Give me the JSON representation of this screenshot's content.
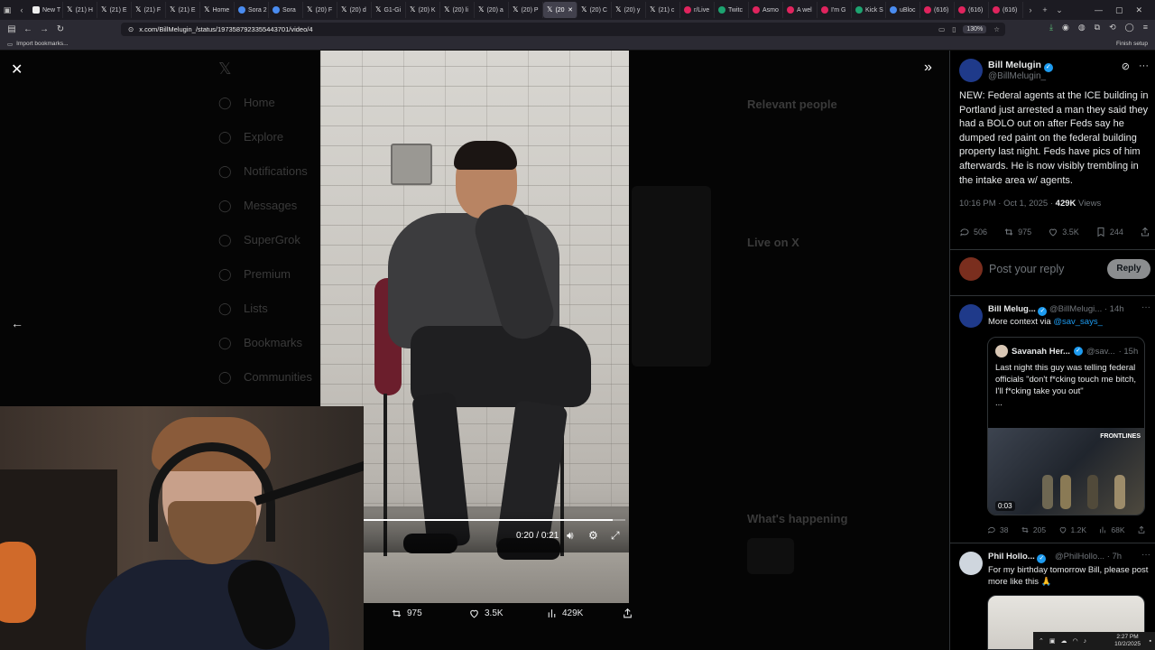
{
  "browser": {
    "tabs": [
      {
        "label": "New T",
        "icon": "firefox-icon"
      },
      {
        "label": "(21) H",
        "icon": "x-icon"
      },
      {
        "label": "(21) E",
        "icon": "x-icon"
      },
      {
        "label": "(21) F",
        "icon": "x-icon"
      },
      {
        "label": "(21) E",
        "icon": "x-icon"
      },
      {
        "label": "Home",
        "icon": "x-icon"
      },
      {
        "label": "Sora 2",
        "icon": "sora-icon"
      },
      {
        "label": "Sora",
        "icon": "sora-icon"
      },
      {
        "label": "(20) F",
        "icon": "x-icon"
      },
      {
        "label": "(20) d",
        "icon": "x-icon"
      },
      {
        "label": "G1-Gi",
        "icon": "x-icon"
      },
      {
        "label": "(20) K",
        "icon": "x-icon"
      },
      {
        "label": "(20) li",
        "icon": "x-icon"
      },
      {
        "label": "(20) a",
        "icon": "x-icon"
      },
      {
        "label": "(20) P",
        "icon": "x-icon"
      },
      {
        "label": "(20",
        "icon": "x-icon"
      },
      {
        "label": "(20) C",
        "icon": "x-icon"
      },
      {
        "label": "(20) y",
        "icon": "x-icon"
      },
      {
        "label": "(21) c",
        "icon": "x-icon"
      },
      {
        "label": "r/Live",
        "icon": "reddit-icon"
      },
      {
        "label": "Twitc",
        "icon": "twitch-icon"
      },
      {
        "label": "Asmo",
        "icon": "asmon-icon"
      },
      {
        "label": "A wel",
        "icon": "youtube-icon"
      },
      {
        "label": "I'm G",
        "icon": "youtube-icon"
      },
      {
        "label": "Kick S",
        "icon": "kick-icon"
      },
      {
        "label": "uBloc",
        "icon": "ublock-icon"
      },
      {
        "label": "(616)",
        "icon": "youtube-icon"
      },
      {
        "label": "(616)",
        "icon": "youtube-icon"
      },
      {
        "label": "(616)",
        "icon": "youtube-icon"
      }
    ],
    "active_tab_index": 15,
    "url": "x.com/BillMelugin_/status/1973587923355443701/video/4",
    "zoom": "130%",
    "bookmark_label": "Import bookmarks...",
    "finish_setup": "Finish setup"
  },
  "background_feed": {
    "nav_items": [
      "Home",
      "Explore",
      "Notifications",
      "Messages",
      "SuperGrok",
      "Premium",
      "Lists",
      "Bookmarks",
      "Communities"
    ],
    "relevant_people": "Relevant people",
    "live_on_x": "Live on X",
    "whats_happening": "What's happening"
  },
  "video": {
    "current_time": "0:20",
    "total_time": "0:21",
    "progress": 0.95,
    "actions": {
      "reposts": "975",
      "likes": "3.5K",
      "views": "429K"
    }
  },
  "tweet": {
    "author_name": "Bill Melugin",
    "author_handle": "@BillMelugin_",
    "text": "NEW: Federal agents at the ICE building in Portland just arrested a man they said they had a BOLO out on after Feds say he dumped red paint on the federal building property last night. Feds have pics of him afterwards. He is now visibly trembling in the intake area w/ agents.",
    "time": "10:16 PM · Oct 1, 2025 · ",
    "views": "429K",
    "views_label": " Views",
    "replies": "506",
    "reposts": "975",
    "likes": "3.5K",
    "bookmarks": "244",
    "reply_placeholder": "Post your reply",
    "reply_button": "Reply"
  },
  "replies": [
    {
      "name": "Bill Melug...",
      "handle": "@BillMelugi...",
      "age": "· 14h",
      "text_prefix": "More context via ",
      "mention": "@sav_says_",
      "quote": {
        "name": "Savanah Her...",
        "handle": "@sav...",
        "age": "· 15h",
        "text": "Last night this guy was telling federal officials \"don't f*cking touch me bitch, I'll f*cking take you out\"",
        "ellipsis": "...",
        "video_duration": "0:03",
        "brand": "FRONTLINES"
      },
      "stats": {
        "replies": "38",
        "reposts": "205",
        "likes": "1.2K",
        "views": "68K"
      }
    },
    {
      "name": "Phil Hollo...",
      "handle": "@PhilHollo...",
      "age": "· 7h",
      "text": "For my birthday tomorrow Bill, please post more like this 🙏"
    }
  ],
  "system": {
    "time": "2:27 PM",
    "date": "10/2/2025"
  },
  "colors": {
    "accent": "#1d9bf0",
    "background": "#000000",
    "muted_text": "#71767b",
    "border": "#2f3336"
  }
}
